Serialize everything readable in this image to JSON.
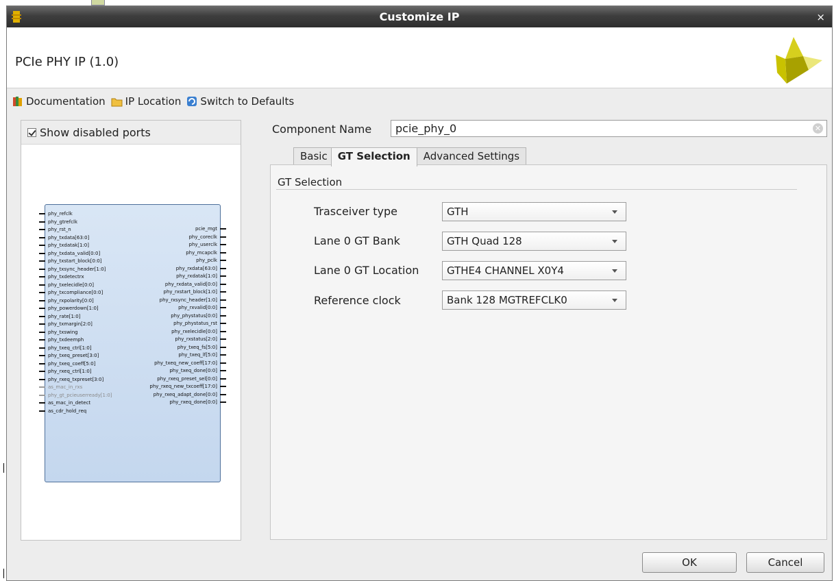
{
  "window": {
    "title": "Customize IP",
    "close_glyph": "×"
  },
  "header": {
    "ip_title": "PCIe PHY IP (1.0)"
  },
  "toolbar": {
    "documentation": "Documentation",
    "ip_location": "IP Location",
    "switch_defaults": "Switch to Defaults"
  },
  "left_panel": {
    "show_disabled_ports": "Show disabled ports",
    "show_disabled_checked": true
  },
  "symbol": {
    "left_ports": [
      {
        "label": "phy_refclk",
        "disabled": false
      },
      {
        "label": "phy_gtrefclk",
        "disabled": false
      },
      {
        "label": "phy_rst_n",
        "disabled": false
      },
      {
        "label": "phy_txdata[63:0]",
        "disabled": false
      },
      {
        "label": "phy_txdatak[1:0]",
        "disabled": false
      },
      {
        "label": "phy_txdata_valid[0:0]",
        "disabled": false
      },
      {
        "label": "phy_txstart_block[0:0]",
        "disabled": false
      },
      {
        "label": "phy_txsync_header[1:0]",
        "disabled": false
      },
      {
        "label": "phy_txdetectrx",
        "disabled": false
      },
      {
        "label": "phy_txelecidle[0:0]",
        "disabled": false
      },
      {
        "label": "phy_txcompliance[0:0]",
        "disabled": false
      },
      {
        "label": "phy_rxpolarity[0:0]",
        "disabled": false
      },
      {
        "label": "phy_powerdown[1:0]",
        "disabled": false
      },
      {
        "label": "phy_rate[1:0]",
        "disabled": false
      },
      {
        "label": "phy_txmargin[2:0]",
        "disabled": false
      },
      {
        "label": "phy_txswing",
        "disabled": false
      },
      {
        "label": "phy_txdeemph",
        "disabled": false
      },
      {
        "label": "phy_txeq_ctrl[1:0]",
        "disabled": false
      },
      {
        "label": "phy_txeq_preset[3:0]",
        "disabled": false
      },
      {
        "label": "phy_txeq_coeff[5:0]",
        "disabled": false
      },
      {
        "label": "phy_rxeq_ctrl[1:0]",
        "disabled": false
      },
      {
        "label": "phy_rxeq_txpreset[3:0]",
        "disabled": false
      },
      {
        "label": "as_mac_in_rxs",
        "disabled": true
      },
      {
        "label": "phy_gt_pcieuserready[1:0]",
        "disabled": true
      },
      {
        "label": "as_mac_in_detect",
        "disabled": false
      },
      {
        "label": "as_cdr_hold_req",
        "disabled": false
      }
    ],
    "right_ports": [
      {
        "label": "pcie_mgt",
        "disabled": false
      },
      {
        "label": "phy_coreclk",
        "disabled": false
      },
      {
        "label": "phy_userclk",
        "disabled": false
      },
      {
        "label": "phy_mcapclk",
        "disabled": false
      },
      {
        "label": "phy_pclk",
        "disabled": false
      },
      {
        "label": "phy_rxdata[63:0]",
        "disabled": false
      },
      {
        "label": "phy_rxdatak[1:0]",
        "disabled": false
      },
      {
        "label": "phy_rxdata_valid[0:0]",
        "disabled": false
      },
      {
        "label": "phy_rxstart_block[1:0]",
        "disabled": false
      },
      {
        "label": "phy_rxsync_header[1:0]",
        "disabled": false
      },
      {
        "label": "phy_rxvalid[0:0]",
        "disabled": false
      },
      {
        "label": "phy_phystatus[0:0]",
        "disabled": false
      },
      {
        "label": "phy_phystatus_rst",
        "disabled": false
      },
      {
        "label": "phy_rxelecidle[0:0]",
        "disabled": false
      },
      {
        "label": "phy_rxstatus[2:0]",
        "disabled": false
      },
      {
        "label": "phy_txeq_fs[5:0]",
        "disabled": false
      },
      {
        "label": "phy_txeq_lf[5:0]",
        "disabled": false
      },
      {
        "label": "phy_txeq_new_coeff[17:0]",
        "disabled": false
      },
      {
        "label": "phy_txeq_done[0:0]",
        "disabled": false
      },
      {
        "label": "phy_rxeq_preset_sel[0:0]",
        "disabled": false
      },
      {
        "label": "phy_rxeq_new_txcoeff[17:0]",
        "disabled": false
      },
      {
        "label": "phy_rxeq_adapt_done[0:0]",
        "disabled": false
      },
      {
        "label": "phy_rxeq_done[0:0]",
        "disabled": false
      }
    ]
  },
  "component": {
    "label": "Component Name",
    "value": "pcie_phy_0"
  },
  "tabs": [
    {
      "label": "Basic",
      "active": false
    },
    {
      "label": "GT Selection",
      "active": true
    },
    {
      "label": "Advanced Settings",
      "active": false
    }
  ],
  "gt_selection": {
    "group_title": "GT Selection",
    "fields": [
      {
        "label": "Trasceiver type",
        "value": "GTH"
      },
      {
        "label": "Lane 0 GT Bank",
        "value": "GTH Quad 128"
      },
      {
        "label": "Lane 0 GT Location",
        "value": "GTHE4 CHANNEL X0Y4"
      },
      {
        "label": "Reference clock",
        "value": "Bank 128 MGTREFCLK0"
      }
    ]
  },
  "buttons": {
    "ok": "OK",
    "cancel": "Cancel"
  },
  "colors": {
    "titlebar": "#3e3e3e",
    "logo": "#c8c400",
    "block_fill": "#c4d7ee"
  }
}
